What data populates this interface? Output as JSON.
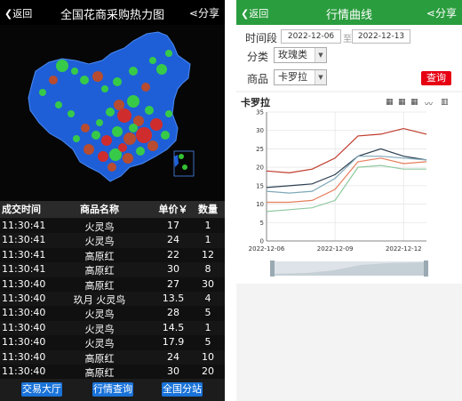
{
  "left": {
    "header": {
      "back": "返回",
      "title": "全国花商采购热力图",
      "share": "分享"
    },
    "table": {
      "columns": [
        "成交时间",
        "商品名称",
        "单价￥",
        "数量"
      ],
      "rows": [
        [
          "11:30:41",
          "火灵鸟",
          "17",
          "1"
        ],
        [
          "11:30:41",
          "火灵鸟",
          "24",
          "1"
        ],
        [
          "11:30:41",
          "高原红",
          "22",
          "12"
        ],
        [
          "11:30:41",
          "高原红",
          "30",
          "8"
        ],
        [
          "11:30:40",
          "高原红",
          "27",
          "30"
        ],
        [
          "11:30:40",
          "玖月 火灵鸟",
          "13.5",
          "4"
        ],
        [
          "11:30:40",
          "火灵鸟",
          "28",
          "5"
        ],
        [
          "11:30:40",
          "火灵鸟",
          "14.5",
          "1"
        ],
        [
          "11:30:40",
          "火灵鸟",
          "17.9",
          "5"
        ],
        [
          "11:30:40",
          "高原红",
          "24",
          "10"
        ],
        [
          "11:30:40",
          "高原红",
          "30",
          "20"
        ]
      ]
    },
    "footer": {
      "btn1": "交易大厅",
      "btn2": "行情查询",
      "btn3": "全国分站"
    }
  },
  "right": {
    "header": {
      "back": "返回",
      "title": "行情曲线",
      "share": "分享"
    },
    "form": {
      "time_label": "时间段",
      "date_from": "2022-12-06",
      "to_label": "至",
      "date_to": "2022-12-13",
      "category_label": "分类",
      "category_value": "玫瑰类",
      "product_label": "商品",
      "product_value": "卡罗拉",
      "query_button": "查询"
    }
  },
  "chart_data": {
    "type": "line",
    "title": "卡罗拉",
    "x": [
      "2022-12-06",
      "2022-12-07",
      "2022-12-08",
      "2022-12-09",
      "2022-12-10",
      "2022-12-11",
      "2022-12-12",
      "2022-12-13"
    ],
    "x_tick_labels": [
      "2022-12-06",
      "2022-12-09",
      "2022-12-12"
    ],
    "ylim": [
      0,
      35
    ],
    "yticks": [
      0,
      5,
      10,
      15,
      20,
      25,
      30,
      35
    ],
    "series": [
      {
        "color": "#c0392b",
        "values": [
          19,
          18.5,
          19.5,
          22.5,
          28.5,
          29,
          30.5,
          29
        ]
      },
      {
        "color": "#2c3e50",
        "values": [
          14.5,
          15,
          15.5,
          18,
          23,
          25,
          23,
          22
        ]
      },
      {
        "color": "#7fa8b8",
        "values": [
          13.5,
          13,
          13.5,
          17,
          23,
          23,
          22.5,
          22
        ]
      },
      {
        "color": "#e67e5b",
        "values": [
          10.5,
          10.5,
          11,
          14,
          21.5,
          22.5,
          21,
          21.5
        ]
      },
      {
        "color": "#8fc9a0",
        "values": [
          8,
          8.5,
          9,
          11,
          20,
          20.5,
          19.5,
          19.5
        ]
      }
    ],
    "grid": true
  }
}
